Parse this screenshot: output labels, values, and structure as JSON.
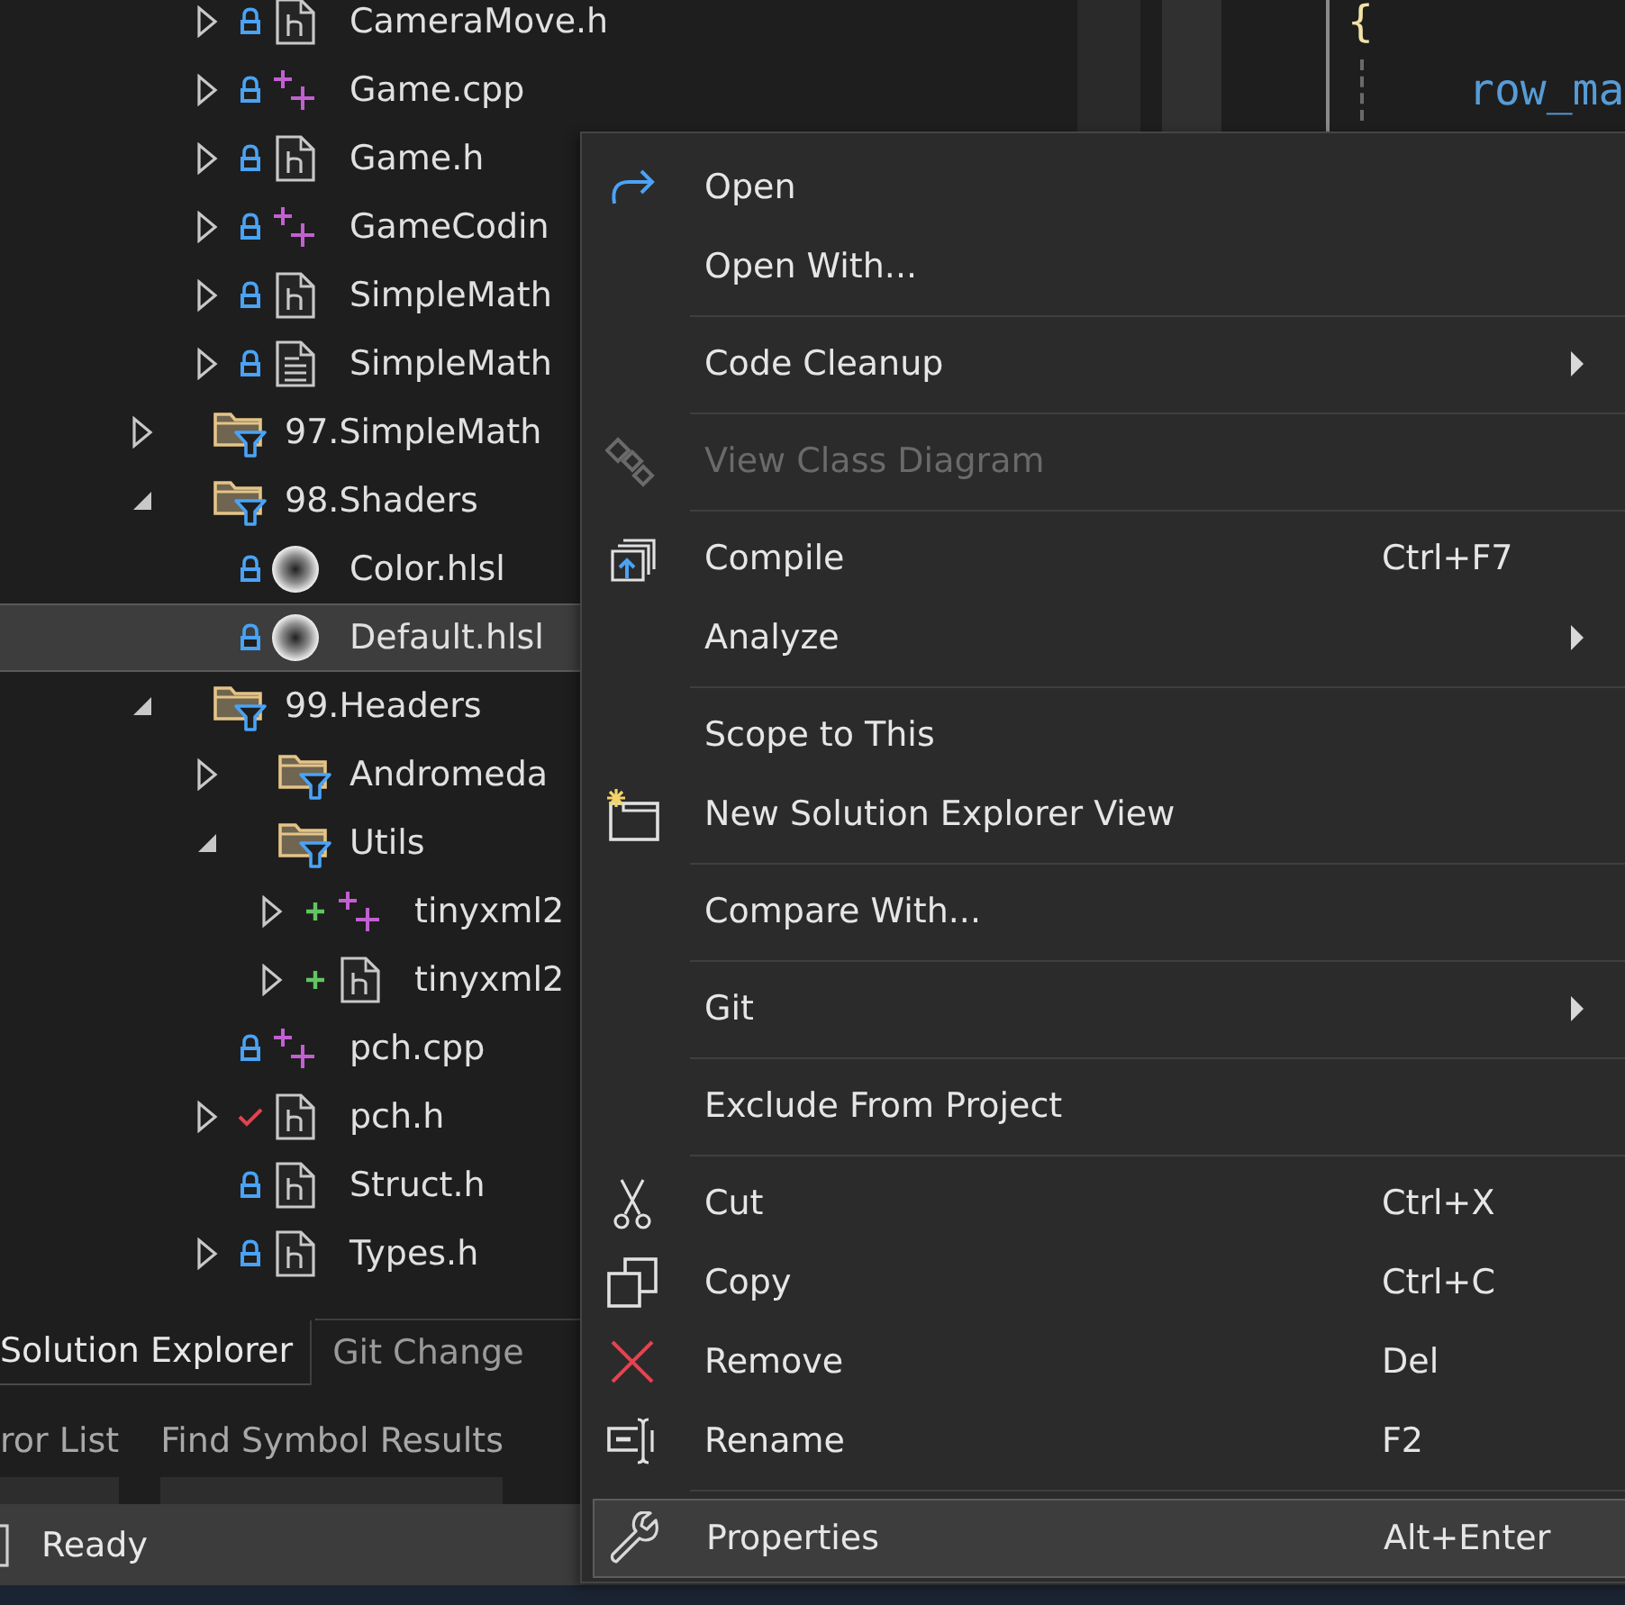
{
  "tree": [
    {
      "children": [
        {
          "label": "CameraMove.h",
          "kind": "header",
          "locked": true,
          "added": false,
          "modified": false,
          "expanded": false,
          "selected": false
        },
        {
          "label": "Game.cpp",
          "kind": "source",
          "locked": true,
          "added": false,
          "modified": false,
          "expanded": false,
          "selected": false
        },
        {
          "label": "Game.h",
          "kind": "header",
          "locked": true,
          "added": false,
          "modified": false,
          "expanded": false,
          "selected": false
        },
        {
          "label": "GameCodin",
          "kind": "source",
          "locked": true,
          "added": false,
          "modified": false,
          "expanded": false,
          "selected": false
        },
        {
          "label": "SimpleMath",
          "kind": "header",
          "locked": true,
          "added": false,
          "modified": false,
          "expanded": false,
          "selected": false
        },
        {
          "label": "SimpleMath",
          "kind": "text",
          "locked": true,
          "added": false,
          "modified": false,
          "expanded": false,
          "selected": false
        }
      ]
    },
    {
      "label": "97.SimpleMath",
      "kind": "folder",
      "expanded": false,
      "selected": false
    },
    {
      "label": "98.Shaders",
      "kind": "folder",
      "expanded": true,
      "selected": false,
      "children": [
        {
          "label": "Color.hlsl",
          "kind": "shader",
          "locked": true,
          "added": false,
          "modified": false,
          "selected": false
        },
        {
          "label": "Default.hlsl",
          "kind": "shader",
          "locked": true,
          "added": false,
          "modified": false,
          "selected": true
        }
      ]
    },
    {
      "label": "99.Headers",
      "kind": "folder",
      "expanded": true,
      "selected": false,
      "children": [
        {
          "label": "Andromeda",
          "kind": "folder",
          "expanded": false,
          "selected": false
        },
        {
          "label": "Utils",
          "kind": "folder",
          "expanded": true,
          "selected": false,
          "children": [
            {
              "label": "tinyxml2",
              "kind": "source",
              "locked": false,
              "added": true,
              "modified": false,
              "expanded": false,
              "selected": false
            },
            {
              "label": "tinyxml2",
              "kind": "header",
              "locked": false,
              "added": true,
              "modified": false,
              "expanded": false,
              "selected": false
            }
          ]
        },
        {
          "label": "pch.cpp",
          "kind": "source",
          "locked": true,
          "added": false,
          "modified": false,
          "selected": false
        },
        {
          "label": "pch.h",
          "kind": "header",
          "locked": false,
          "added": false,
          "modified": true,
          "expanded": false,
          "selected": false
        },
        {
          "label": "Struct.h",
          "kind": "header",
          "locked": true,
          "added": false,
          "modified": false,
          "selected": false
        },
        {
          "label": "Types.h",
          "kind": "header",
          "locked": true,
          "added": false,
          "modified": false,
          "expanded": false,
          "selected": false
        }
      ]
    }
  ],
  "editor": {
    "lines": [
      {
        "text": "{",
        "kind": "brace"
      },
      {
        "text": "row_ma",
        "kind": "identifier"
      }
    ]
  },
  "panel_tabs": [
    {
      "label": "Solution Explorer",
      "selected": true
    },
    {
      "label": "Git Change",
      "selected": false
    }
  ],
  "tool_tabs": [
    {
      "label": "ror List"
    },
    {
      "label": "Find Symbol Results"
    }
  ],
  "status_bar": {
    "text": "Ready"
  },
  "context_menu": {
    "items": [
      {
        "kind": "item",
        "label": "Open",
        "submenu": false,
        "disabled": false,
        "selected": false
      },
      {
        "kind": "item",
        "label": "Open With...",
        "submenu": false,
        "disabled": false,
        "selected": false
      },
      {
        "kind": "separator"
      },
      {
        "kind": "item",
        "label": "Code Cleanup",
        "submenu": true,
        "disabled": false,
        "selected": false
      },
      {
        "kind": "separator"
      },
      {
        "kind": "item",
        "label": "View Class Diagram",
        "submenu": false,
        "disabled": true,
        "selected": false
      },
      {
        "kind": "separator"
      },
      {
        "kind": "item",
        "label": "Compile",
        "shortcut": "Ctrl+F7",
        "submenu": false,
        "disabled": false,
        "selected": false
      },
      {
        "kind": "item",
        "label": "Analyze",
        "submenu": true,
        "disabled": false,
        "selected": false
      },
      {
        "kind": "separator"
      },
      {
        "kind": "item",
        "label": "Scope to This",
        "submenu": false,
        "disabled": false,
        "selected": false
      },
      {
        "kind": "item",
        "label": "New Solution Explorer View",
        "submenu": false,
        "disabled": false,
        "selected": false
      },
      {
        "kind": "separator"
      },
      {
        "kind": "item",
        "label": "Compare With...",
        "submenu": false,
        "disabled": false,
        "selected": false
      },
      {
        "kind": "separator"
      },
      {
        "kind": "item",
        "label": "Git",
        "submenu": true,
        "disabled": false,
        "selected": false
      },
      {
        "kind": "separator"
      },
      {
        "kind": "item",
        "label": "Exclude From Project",
        "submenu": false,
        "disabled": false,
        "selected": false
      },
      {
        "kind": "separator"
      },
      {
        "kind": "item",
        "label": "Cut",
        "shortcut": "Ctrl+X",
        "submenu": false,
        "disabled": false,
        "selected": false
      },
      {
        "kind": "item",
        "label": "Copy",
        "shortcut": "Ctrl+C",
        "submenu": false,
        "disabled": false,
        "selected": false
      },
      {
        "kind": "item",
        "label": "Remove",
        "shortcut": "Del",
        "submenu": false,
        "disabled": false,
        "selected": false
      },
      {
        "kind": "item",
        "label": "Rename",
        "shortcut": "F2",
        "submenu": false,
        "disabled": false,
        "selected": false
      },
      {
        "kind": "separator"
      },
      {
        "kind": "item",
        "label": "Properties",
        "shortcut": "Alt+Enter",
        "submenu": false,
        "disabled": false,
        "selected": true
      }
    ]
  }
}
